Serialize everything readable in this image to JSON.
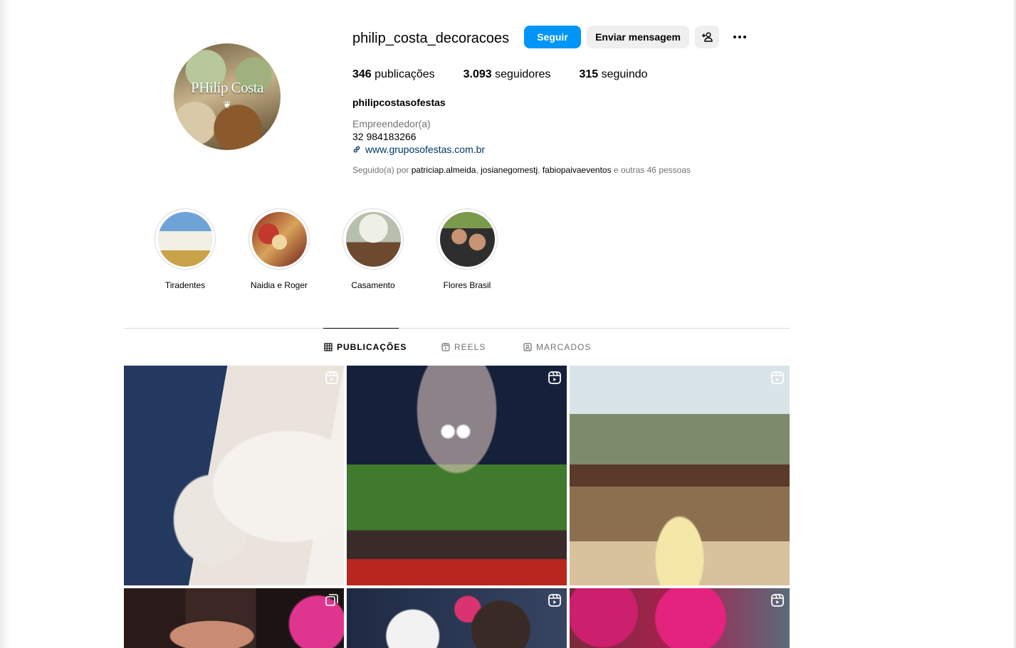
{
  "profile": {
    "username": "philip_costa_decoracoes",
    "avatar_text": "PHilip Costa",
    "buttons": {
      "follow": "Seguir",
      "message": "Enviar mensagem"
    },
    "stats": {
      "posts_count": "346",
      "posts_label": "publicações",
      "followers_count": "3.093",
      "followers_label": "seguidores",
      "following_count": "315",
      "following_label": "seguindo"
    },
    "full_name": "philipcostasofestas",
    "category": "Empreendedor(a)",
    "phone": "32 984183266",
    "website": "www.gruposofestas.com.br",
    "followed_by": {
      "prefix": "Seguido(a) por",
      "user1": "patriciap.almeida",
      "user2": "josianegomestj",
      "user3": "fabiopaivaeventos",
      "suffix": "e outras 46 pessoas"
    }
  },
  "highlights": [
    {
      "label": "Tiradentes"
    },
    {
      "label": "Naidia e Roger"
    },
    {
      "label": "Casamento"
    },
    {
      "label": "Flores Brasil"
    }
  ],
  "tabs": {
    "posts": "PUBLICAÇÕES",
    "reels": "REELS",
    "tagged": "MARCADOS"
  },
  "colors": {
    "accent": "#0095f6",
    "link": "#00376b",
    "muted": "#737373",
    "button_gray": "#efefef"
  },
  "icons": {
    "more": "more-icon",
    "add_user": "add-user-icon",
    "link": "link-icon",
    "grid": "grid-icon",
    "reels": "reels-icon",
    "tagged": "tagged-icon",
    "reel_badge": "reel-badge-icon",
    "carousel_badge": "carousel-badge-icon"
  }
}
